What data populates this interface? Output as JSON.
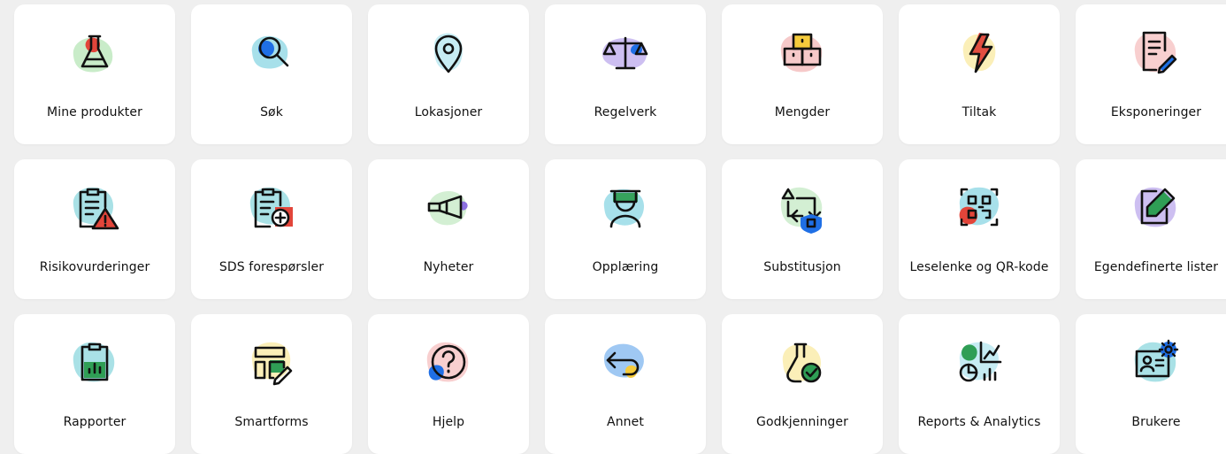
{
  "tiles": [
    {
      "label": "Mine produkter",
      "icon": "flask-icon",
      "blob": "#c9ecc9"
    },
    {
      "label": "Søk",
      "icon": "search-icon",
      "blob": "#a7e0ea"
    },
    {
      "label": "Lokasjoner",
      "icon": "location-pin-icon",
      "blob": "#c6ecf3"
    },
    {
      "label": "Regelverk",
      "icon": "scales-icon",
      "blob": "#cdbff1"
    },
    {
      "label": "Mengder",
      "icon": "boxes-icon",
      "blob": "#f6c9c9"
    },
    {
      "label": "Tiltak",
      "icon": "lightning-icon",
      "blob": "#fbefb8"
    },
    {
      "label": "Eksponeringer",
      "icon": "document-edit-icon",
      "blob": "#f8cfcf"
    },
    {
      "label": "Risikovurderinger",
      "icon": "clipboard-warning-icon",
      "blob": "#a9e1e6"
    },
    {
      "label": "SDS forespørsler",
      "icon": "clipboard-add-icon",
      "blob": "#a9e1e6"
    },
    {
      "label": "Nyheter",
      "icon": "megaphone-icon",
      "blob": "#d3efd3"
    },
    {
      "label": "Opplæring",
      "icon": "graduate-icon",
      "blob": "#a7e0ea"
    },
    {
      "label": "Substitusjon",
      "icon": "swap-shield-icon",
      "blob": "#d3efd3"
    },
    {
      "label": "Leselenke og QR-kode",
      "icon": "qr-code-icon",
      "blob": "#a7e0ea"
    },
    {
      "label": "Egendefinerte lister",
      "icon": "edit-square-icon",
      "blob": "#cdbff1"
    },
    {
      "label": "Rapporter",
      "icon": "clipboard-chart-icon",
      "blob": "#a9e1e6"
    },
    {
      "label": "Smartforms",
      "icon": "form-layout-icon",
      "blob": "#fbefb8"
    },
    {
      "label": "Hjelp",
      "icon": "help-question-icon",
      "blob": "#f8cfcf"
    },
    {
      "label": "Annet",
      "icon": "return-arrow-icon",
      "blob": "#9fc8f3"
    },
    {
      "label": "Godkjenninger",
      "icon": "flask-check-icon",
      "blob": "#fbefb8"
    },
    {
      "label": "Reports & Analytics",
      "icon": "analytics-icon",
      "blob": "#c6ecf3"
    },
    {
      "label": "Brukere",
      "icon": "user-settings-icon",
      "blob": "#a9e1e6"
    }
  ],
  "colors": {
    "background": "#efefef",
    "tile": "#ffffff",
    "accent_blue": "#1f6fe5",
    "accent_red": "#e2453a",
    "accent_green": "#2f9e55",
    "accent_purple": "#8b6fe0"
  }
}
